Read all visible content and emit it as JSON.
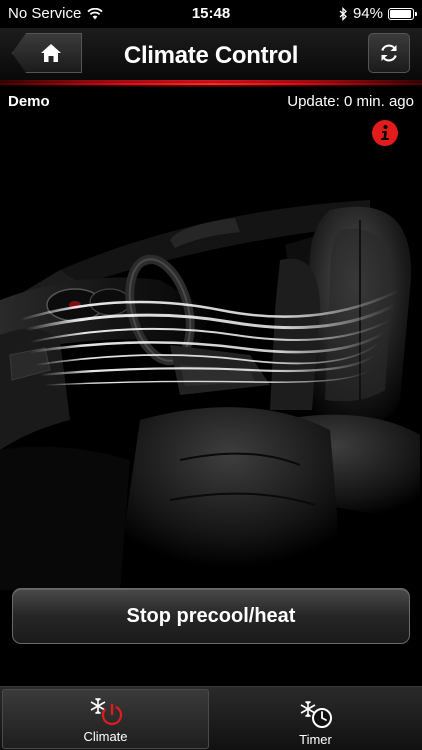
{
  "status_bar": {
    "carrier": "No Service",
    "time": "15:48",
    "battery": "94%",
    "battery_level": 0.94
  },
  "nav": {
    "title": "Climate Control",
    "home_icon": "home-icon",
    "refresh_icon": "refresh-icon"
  },
  "info": {
    "mode": "Demo",
    "update": "Update: 0 min. ago",
    "info_icon": "info-icon"
  },
  "actions": {
    "stop_label": "Stop precool/heat"
  },
  "tabs": [
    {
      "label": "Climate",
      "icon": "climate-power-icon",
      "active": true
    },
    {
      "label": "Timer",
      "icon": "climate-timer-icon",
      "active": false
    }
  ],
  "colors": {
    "accent_red": "#e21b1b",
    "background": "#000000"
  }
}
